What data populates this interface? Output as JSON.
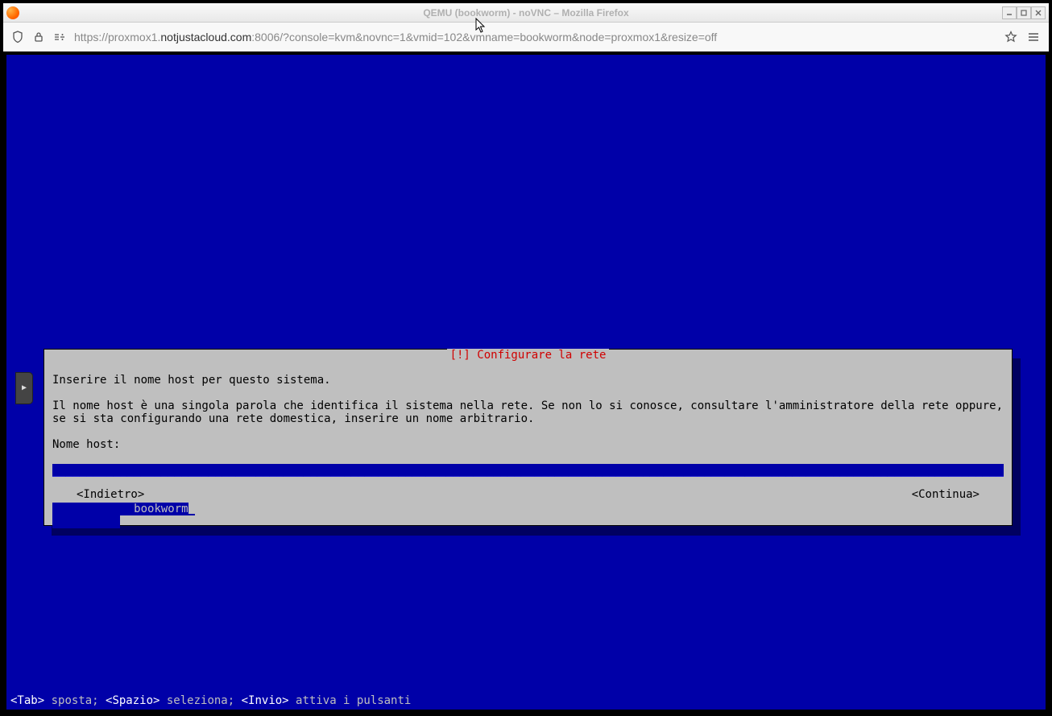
{
  "window": {
    "title": "QEMU (bookworm) - noVNC – Mozilla Firefox"
  },
  "addressbar": {
    "url_pre": "https://proxmox1.",
    "url_domain": "notjustacloud.com",
    "url_post": ":8006/?console=kvm&novnc=1&vmid=102&vmname=bookworm&node=proxmox1&resize=off"
  },
  "dialog": {
    "title": "[!] Configurare la rete",
    "paragraph1": "Inserire il nome host per questo sistema.",
    "paragraph2": "Il nome host è una singola parola che identifica il sistema nella rete. Se non lo si conosce, consultare l'amministratore della rete oppure, se si sta configurando una rete domestica, inserire un nome arbitrario.",
    "field_label": "Nome host:",
    "input_value": "bookworm",
    "back_label": "<Indietro>",
    "continue_label": "<Continua>"
  },
  "helpline": {
    "tab": "<Tab>",
    "tab_txt": " sposta; ",
    "space": "<Spazio>",
    "space_txt": " seleziona; ",
    "enter": "<Invio>",
    "enter_txt": " attiva i pulsanti"
  },
  "colors": {
    "installer_blue": "#0000a8",
    "dialog_gray": "#bfbfbf",
    "title_red": "#d00000"
  }
}
